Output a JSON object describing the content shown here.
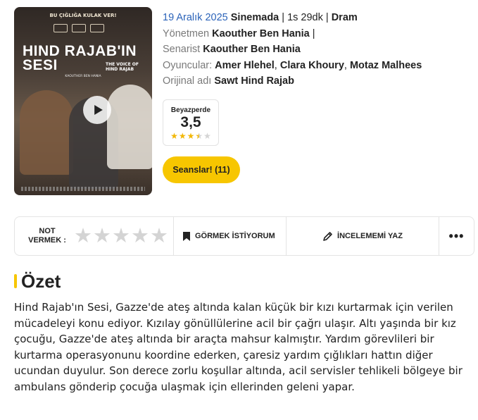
{
  "poster": {
    "tagline": "BU ÇIĞLIĞA KULAK VER!",
    "title": "HIND RAJAB'IN SESI",
    "subtitle": "THE VOICE OF HIND RAJAB",
    "director_credit": "KAOUTHER BEN HANIA"
  },
  "movie": {
    "release_date": "19 Aralık 2025",
    "release_status": "Sinemada",
    "sep1": " | ",
    "duration": "1s 29dk",
    "sep2": " | ",
    "genre": "Dram",
    "director_label": "Yönetmen",
    "director": "Kaouther Ben Hania",
    "director_trail": " |",
    "writer_label": "Senarist",
    "writer": "Kaouther Ben Hania",
    "cast_label": "Oyuncular:",
    "cast": [
      "Amer Hlehel",
      "Clara Khoury",
      "Motaz Malhees"
    ],
    "comma": ", ",
    "original_title_label": "Orijinal adı",
    "original_title": "Sawt Hind Rajab"
  },
  "rating": {
    "source": "Beyazperde",
    "score": "3,5",
    "value": 3.5,
    "max": 5
  },
  "sessions_button": "Seanslar! (11)",
  "actions": {
    "rate_label_1": "NOT",
    "rate_label_2": "VERMEK :",
    "want_label": "GÖRMEK İSTİYORUM",
    "review_label": "İNCELEMEMİ YAZ",
    "more_label": "•••"
  },
  "summary": {
    "heading": "Özet",
    "text": "Hind Rajab'ın Sesi, Gazze'de ateş altında kalan küçük bir kızı kurtarmak için verilen mücadeleyi konu ediyor. Kızılay gönüllülerine acil bir çağrı ulaşır. Altı yaşında bir kız çocuğu, Gazze'de ateş altında bir araçta mahsur kalmıştır. Yardım görevlileri bir kurtarma operasyonunu koordine ederken, çaresiz yardım çığlıkları hattın diğer ucundan duyulur. Son derece zorlu koşullar altında, acil servisler tehlikeli bölgeye bir ambulans gönderip çocuğa ulaşmak için ellerinden geleni yapar."
  },
  "colors": {
    "accent_yellow": "#f7c600",
    "link_blue": "#2b63b9",
    "muted_gray": "#7a7a7a",
    "star_filled": "#f2b705",
    "star_empty": "#d4d4d4"
  }
}
